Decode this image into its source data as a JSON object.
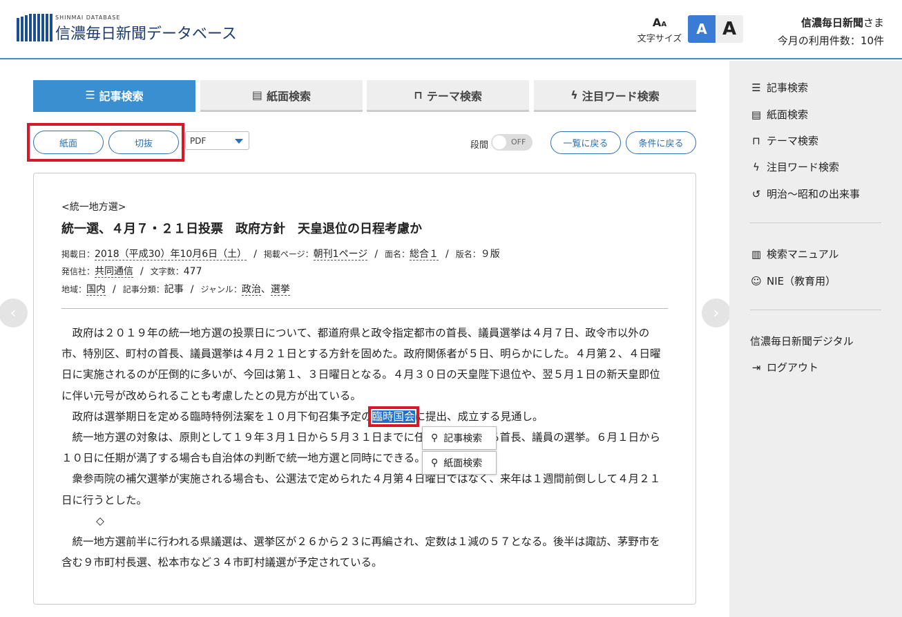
{
  "header": {
    "logo_sub": "SHINMAI DATABASE",
    "logo_main": "信濃毎日新聞データベース",
    "font_size_label": "文字サイズ",
    "font_small": "A",
    "font_large": "A",
    "user_name": "信濃毎日新聞",
    "user_suffix": "さま",
    "usage": "今月の利用件数：10件"
  },
  "tabs": [
    {
      "label": "記事検索",
      "icon": "list-icon",
      "active": true
    },
    {
      "label": "紙面検索",
      "icon": "newspaper-icon",
      "active": false
    },
    {
      "label": "テーマ検索",
      "icon": "bookmark-icon",
      "active": false
    },
    {
      "label": "注目ワード検索",
      "icon": "bolt-icon",
      "active": false
    }
  ],
  "controls": {
    "paper_button": "紙面",
    "clip_button": "切抜",
    "format_select": "PDF",
    "toggle_label": "段間",
    "toggle_state": "OFF",
    "back_list": "一覧に戻る",
    "back_conditions": "条件に戻る"
  },
  "article": {
    "kicker": "<統一地方選>",
    "headline": "統一選、４月７・２１日投票　政府方針　天皇退位の日程考慮か",
    "date_key": "掲載日：",
    "date_val": "2018（平成30）年10月6日（土）",
    "page_key": "掲載ページ：",
    "page_val": "朝刊1ページ",
    "face_key": "面名：",
    "face_val": "総合１",
    "edition_key": "版名：",
    "edition_val": "９版",
    "source_key": "発信社：",
    "source_val": "共同通信",
    "chars_key": "文字数：",
    "chars_val": "477",
    "region_key": "地域：",
    "region_val": "国内",
    "category_key": "記事分類：",
    "category_val": "記事",
    "genre_key": "ジャンル：",
    "genre_val1": "政治",
    "genre_sep": "、",
    "genre_val2": "選挙",
    "sep": "/",
    "p1": "政府は２０１９年の統一地方選の投票日について、都道府県と政令指定都市の首長、議員選挙は４月７日、政令市以外の市、特別区、町村の首長、議員選挙は４月２１日とする方針を固めた。政府関係者が５日、明らかにした。４月第２、４日曜日に実施されるのが圧倒的に多いが、今回は第１、３日曜日となる。４月３０日の天皇陛下退位や、翌５月１日の新天皇即位に伴い元号が改められることも考慮したとの見方が出ている。",
    "p2_before": "政府は選挙期日を定める臨時特例法案を１０月下旬召集予定の",
    "p2_highlight": "臨時国会",
    "p2_after": "に提出、成立する見通し。",
    "p3": "統一地方選の対象は、原則として１９年３月１日から５月３１日までに任期満了を迎える首長、議員の選挙。６月１日から１０日に任期が満了する場合も自治体の判断で統一地方選と同時にできる。",
    "p4": "衆参両院の補欠選挙が実施される場合も、公選法で定められた４月第４日曜日ではなく、来年は１週間前倒しして４月２１日に行うとした。",
    "diamond": "◇",
    "p5": "統一地方選前半に行われる県議選は、選挙区が２６から２３に再編され、定数は１減の５７となる。後半は諏訪、茅野市を含む９市町村長選、松本市など３４市町村議選が予定されている。"
  },
  "popup": {
    "article_search": "記事検索",
    "paper_search": "紙面検索"
  },
  "sidebar": {
    "items": [
      {
        "label": "記事検索",
        "icon": "list-icon"
      },
      {
        "label": "紙面検索",
        "icon": "newspaper-icon"
      },
      {
        "label": "テーマ検索",
        "icon": "bookmark-icon"
      },
      {
        "label": "注目ワード検索",
        "icon": "bolt-icon"
      },
      {
        "label": "明治～昭和の出来事",
        "icon": "history-icon"
      },
      {
        "label": "検索マニュアル",
        "icon": "book-icon"
      },
      {
        "label": "NIE（教育用）",
        "icon": "nie-icon"
      },
      {
        "label": "信濃毎日新聞デジタル",
        "icon": ""
      },
      {
        "label": "ログアウト",
        "icon": "logout-icon"
      }
    ]
  },
  "colors": {
    "accent": "#3a8fd1",
    "highlight": "#1f6fcf",
    "annotation_red": "#d7182a"
  }
}
